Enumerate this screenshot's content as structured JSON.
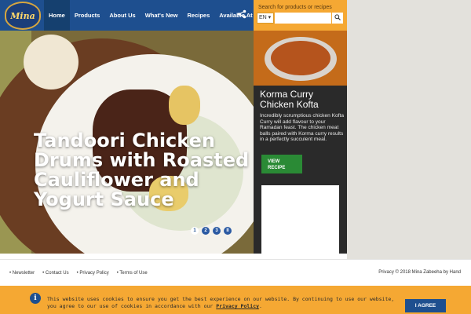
{
  "nav": {
    "logo_text": "Mina",
    "items": [
      {
        "label": "Home",
        "active": true
      },
      {
        "label": "Products"
      },
      {
        "label": "About Us"
      },
      {
        "label": "What's New"
      },
      {
        "label": "Recipes"
      },
      {
        "label": "Available At"
      }
    ],
    "share_icon": "share-icon"
  },
  "search": {
    "placeholder": "Search for products or recipes",
    "language": "EN ▾",
    "icon": "search-icon"
  },
  "hero": {
    "title": "Tandoori Chicken Drums with Roasted Cauliflower and Yogurt Sauce",
    "slides": [
      "1",
      "2",
      "3",
      "II"
    ],
    "active_slide": 1
  },
  "promo": {
    "title": "Korma Curry Chicken Kofta",
    "description": "Incredibly scrumptious chicken Kofta Curry will add flavour to your Ramadan feast. The chicken meat balls paired with Korma curry results in a perfectly succulent meal.",
    "button_label": "VIEW RECIPE"
  },
  "footer": {
    "links": [
      "Newsletter",
      "Contact Us",
      "Privacy Policy",
      "Terms of Use"
    ],
    "copyright": "Privacy © 2018 Mina Zabeeha by Hand"
  },
  "cookie": {
    "text": "This website uses cookies to ensure you get the best experience on our website. By continuing to use our website, you agree to our use of cookies in accordance with our",
    "policy_link": "Privacy Policy",
    "suffix": ".",
    "button_label": "I AGREE"
  },
  "colors": {
    "nav_blue": "#1e4f8f",
    "accent_orange": "#f5a833",
    "button_green": "#2a8a35"
  }
}
